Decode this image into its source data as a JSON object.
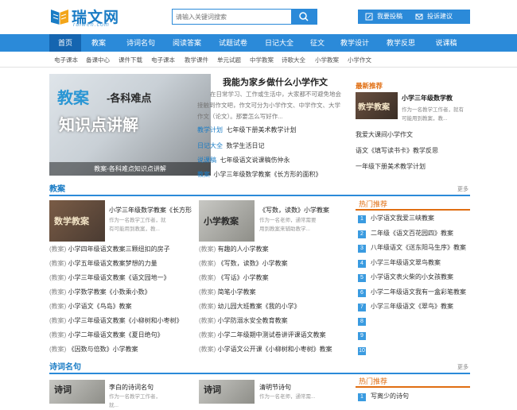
{
  "logo": {
    "name": "瑞文网",
    "sub": "ruiwen.com"
  },
  "search": {
    "placeholder": "请输入关键词搜索"
  },
  "header": {
    "submit_label": "我要投稿",
    "feedback_label": "投诉建议"
  },
  "nav": [
    "首页",
    "教案",
    "诗词名句",
    "阅读答案",
    "试题试卷",
    "日记大全",
    "征文",
    "教学设计",
    "教学反思",
    "说课稿"
  ],
  "subnav": [
    "电子课本",
    "备课中心",
    "课件下载",
    "电子课本",
    "教学课件",
    "单元试题",
    "中学教案",
    "诗歌大全",
    "小学教案",
    "小学作文"
  ],
  "banner": {
    "title_a": "教案",
    "title_b": "-各科难点",
    "title_c": "知识点讲解",
    "caption": "教案-各科难点知识点讲解"
  },
  "featured": {
    "title": "我能为家乡做什么小学作文",
    "desc": "在日常学习、工作或生活中，大家都不可避免地会接触到作文吧，作文可分为小学作文、中学作文、大学作文（论文）。那要怎么写好作...",
    "links": [
      {
        "cat": "教学计划",
        "text": "七年级下册美术教学计划"
      },
      {
        "cat": "日记大全",
        "text": "数学生活日记"
      },
      {
        "cat": "说课稿",
        "text": "七年级语文说课稿伤仲永"
      },
      {
        "cat": "教案",
        "text": "小学三年级数学教案《长方形的面积》"
      }
    ]
  },
  "recommend": {
    "head": "最新推荐",
    "img_label": "教学教案",
    "title": "小学三年级数学教",
    "desc": "作为一名教学工作者，就有可能用到教案，教...",
    "links": [
      "我爱大课间小学作文",
      "语文《填写读书卡》教学反思",
      "一年级下册美术教学计划"
    ]
  },
  "section1": {
    "title": "教案",
    "more": "更多",
    "items": [
      {
        "img": "数学教案",
        "title": "小学三年级数学教案《长方形",
        "desc": "作为一名教学工作者，就有可能用到教案，教..."
      },
      {
        "img": "小学教案",
        "title": "《写数，读数》小学教案",
        "desc": "作为一名老师，通常需要用到教案来辅助教学..."
      }
    ],
    "list_cat": "教案",
    "list_left": [
      "小学四年级语文教案三颗纽扣的房子",
      "小学五年级语文教案梦想的力量",
      "小学三年级语文教案《语文园地一》",
      "小学数学教案《小数乘小数》",
      "小学语文《鸟岛》教案",
      "小学三年级语文教案《小柳树和小枣树》",
      "小学二年级语文教案《夏日绝句》",
      "《因数与倍数》小学教案"
    ],
    "list_right": [
      "有趣的人小学教案",
      "《写数，读数》小学教案",
      "《写话》小学教案",
      "简笔小学教案",
      "幼儿园大班教案《我的小学》",
      "小学防溺水安全教育教案",
      "小学二年级期中测试卷讲评课语文教案",
      "小学语文公开课《小柳树和小枣树》教案"
    ]
  },
  "hot": {
    "head": "热门推荐",
    "more": "更多",
    "items": [
      "小学语文我爱三峡教案",
      "二年级《语文百花园四》教案",
      "八年级语文《送东阳马生序》教案",
      "小学三年级语文翠鸟教案",
      "小学语文表火柴的小女孩教案",
      "小学二年级语文我有一盒彩笔教案",
      "小学三年级语文《翠鸟》教案",
      "",
      "",
      ""
    ]
  },
  "section2": {
    "title": "诗词名句",
    "more": "更多",
    "items": [
      {
        "img": "诗词",
        "title": "李白的诗词名句",
        "desc": "作为一名教学工作者，就..."
      },
      {
        "img": "诗词",
        "title": "清明节诗句",
        "desc": "作为一名老师，通常需..."
      }
    ]
  },
  "hot2": {
    "head": "热门推荐",
    "first": "写离少的诗句"
  }
}
